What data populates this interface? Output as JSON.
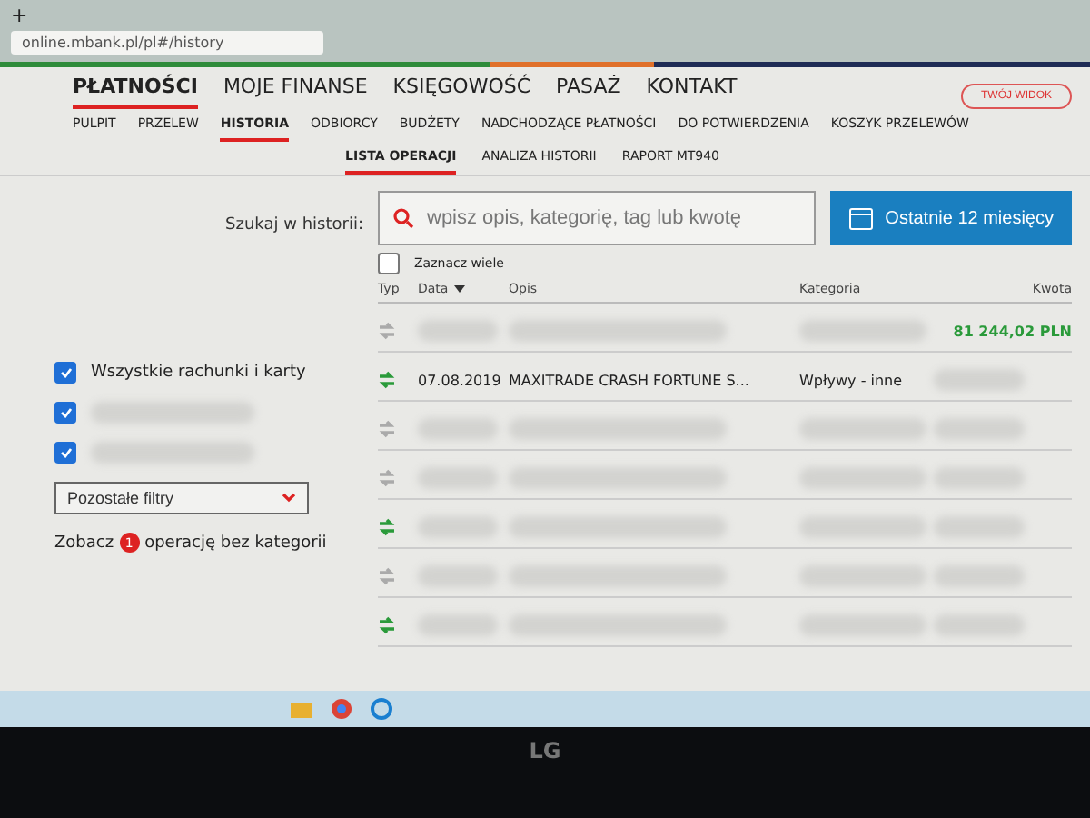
{
  "browser": {
    "new_tab": "+",
    "url": "online.mbank.pl/pl#/history"
  },
  "main_nav": [
    {
      "label": "PŁATNOŚCI",
      "selected": true
    },
    {
      "label": "MOJE FINANSE",
      "selected": false
    },
    {
      "label": "KSIĘGOWOŚĆ",
      "selected": false
    },
    {
      "label": "PASAŻ",
      "selected": false
    },
    {
      "label": "KONTAKT",
      "selected": false
    }
  ],
  "view_button": "TWÓJ WIDOK",
  "sub_nav": [
    {
      "label": "PULPIT",
      "selected": false
    },
    {
      "label": "PRZELEW",
      "selected": false
    },
    {
      "label": "HISTORIA",
      "selected": true
    },
    {
      "label": "ODBIORCY",
      "selected": false
    },
    {
      "label": "BUDŻETY",
      "selected": false
    },
    {
      "label": "NADCHODZĄCE PŁATNOŚCI",
      "selected": false
    },
    {
      "label": "DO POTWIERDZENIA",
      "selected": false
    },
    {
      "label": "KOSZYK PRZELEWÓW",
      "selected": false
    }
  ],
  "history_tabs": [
    {
      "label": "LISTA OPERACJI",
      "selected": true
    },
    {
      "label": "ANALIZA HISTORII",
      "selected": false
    },
    {
      "label": "RAPORT MT940",
      "selected": false
    }
  ],
  "search": {
    "label": "Szukaj w historii:",
    "placeholder": "wpisz opis, kategorię, tag lub kwotę"
  },
  "period_button": "Ostatnie 12 miesięcy",
  "filters": {
    "accounts": [
      {
        "label": "Wszystkie rachunki i karty",
        "checked": true
      },
      {
        "checked": true
      },
      {
        "checked": true
      }
    ],
    "more_filters": "Pozostałe filtry",
    "uncategorized": {
      "prefix": "Zobacz",
      "count": "1",
      "suffix": "operację bez kategorii"
    }
  },
  "table": {
    "select_many": {
      "label": "Zaznacz wiele",
      "checked": false
    },
    "columns": [
      "Typ",
      "Data",
      "Opis",
      "Kategoria",
      "Kwota"
    ],
    "rows": [
      {
        "kind": "other",
        "amount": "81 244,02 PLN"
      },
      {
        "kind": "incoming",
        "date": "07.08.2019",
        "description": "MAXITRADE CRASH FORTUNE S...",
        "category": "Wpływy - inne"
      },
      {
        "kind": "other"
      },
      {
        "kind": "other"
      },
      {
        "kind": "incoming"
      },
      {
        "kind": "other"
      },
      {
        "kind": "incoming"
      }
    ]
  },
  "bezel_logo": "LG"
}
